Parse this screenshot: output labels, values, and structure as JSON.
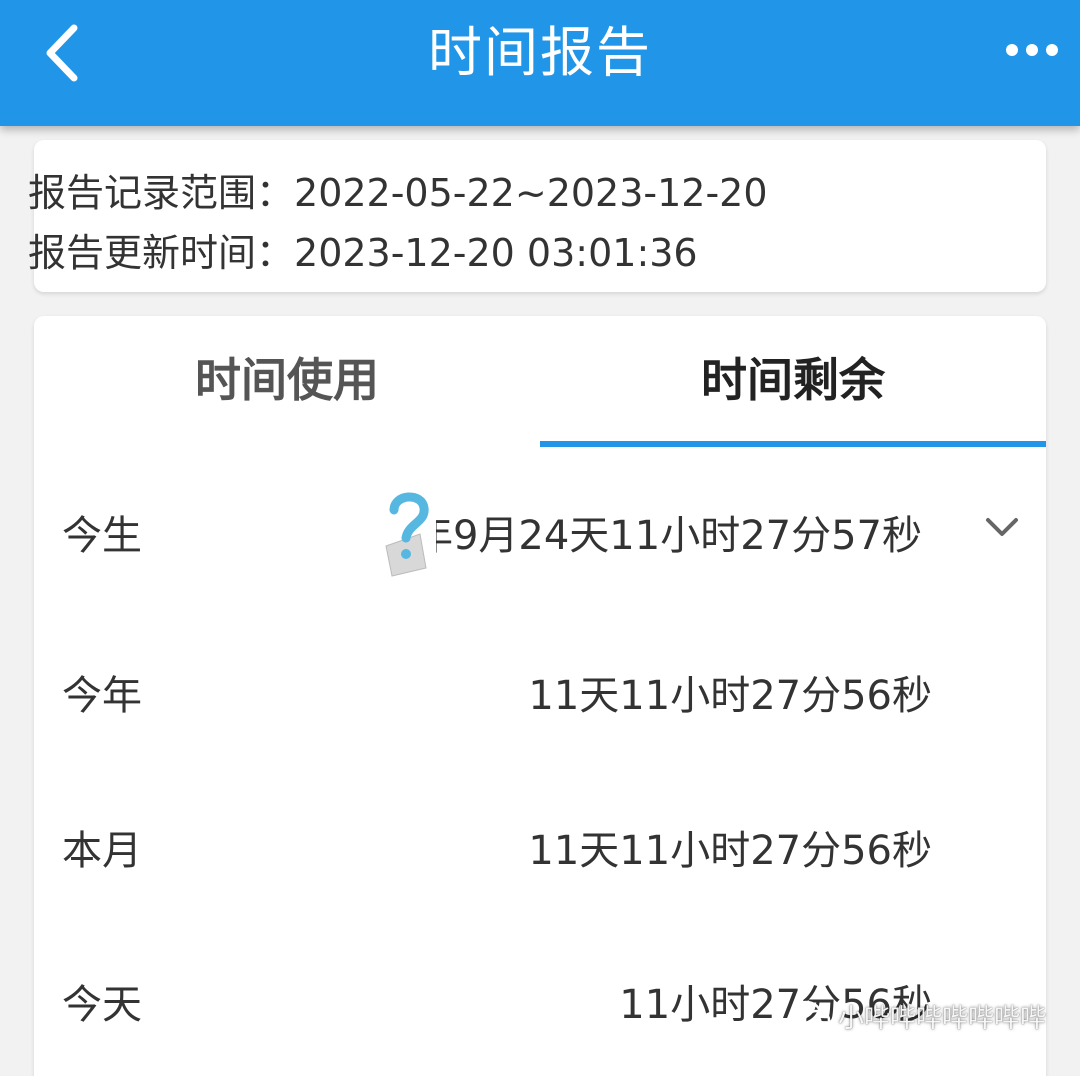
{
  "header": {
    "title": "时间报告",
    "back_icon": "chevron-left-icon",
    "more_icon": "more-horizontal-icon",
    "color": "#2196e8"
  },
  "info": {
    "range_label": "报告记录范围：",
    "range_value": "2022-05-22~2023-12-20",
    "updated_label": "报告更新时间：",
    "updated_value": "2023-12-20 03:01:36"
  },
  "tabs": [
    {
      "label": "时间使用",
      "selected": false
    },
    {
      "label": "时间剩余",
      "selected": true
    }
  ],
  "rows": [
    {
      "label": "今生",
      "value": "年9月24天11小时27分57秒",
      "expandable": true
    },
    {
      "label": "今年",
      "value": "11天11小时27分56秒"
    },
    {
      "label": "本月",
      "value": "11天11小时27分56秒"
    },
    {
      "label": "今天",
      "value": "11小时27分56秒"
    }
  ],
  "watermark": {
    "text": "小哔哔哔哔哔哔哔",
    "icon": "wechat-icon"
  }
}
